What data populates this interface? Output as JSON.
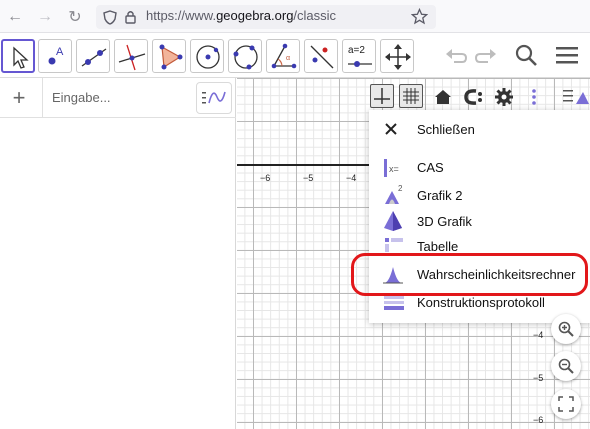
{
  "browser": {
    "url_prefix": "https://www.",
    "url_host": "geogebra.org",
    "url_path": "/classic"
  },
  "toolbar": {
    "tools": [
      "move-tool",
      "point-tool",
      "line-tool",
      "perpendicular-tool",
      "polygon-tool",
      "circle-tool",
      "conic-tool",
      "angle-tool",
      "reflect-tool",
      "slider-tool",
      "move-view-tool"
    ],
    "slider_label": "a=2"
  },
  "algebra": {
    "input_placeholder": "Eingabe..."
  },
  "graphics": {
    "x_ticks": [
      "−6",
      "−5",
      "−4"
    ],
    "y_ticks": [
      "−4",
      "−5",
      "−6"
    ]
  },
  "view_menu": {
    "close_label": "Schließen",
    "items": [
      {
        "label": "CAS",
        "icon": "cas-icon"
      },
      {
        "label": "Grafik 2",
        "icon": "graphics2-icon"
      },
      {
        "label": "3D Grafik",
        "icon": "3d-graphics-icon"
      },
      {
        "label": "Tabelle",
        "icon": "spreadsheet-icon"
      },
      {
        "label": "Wahrscheinlichkeitsrechner",
        "icon": "probability-icon"
      },
      {
        "label": "Konstruktionsprotokoll",
        "icon": "construction-protocol-icon"
      }
    ],
    "highlight_color": "#e2171a"
  },
  "colors": {
    "accent": "#6557d2",
    "icon_purple": "#7a6ed6"
  }
}
